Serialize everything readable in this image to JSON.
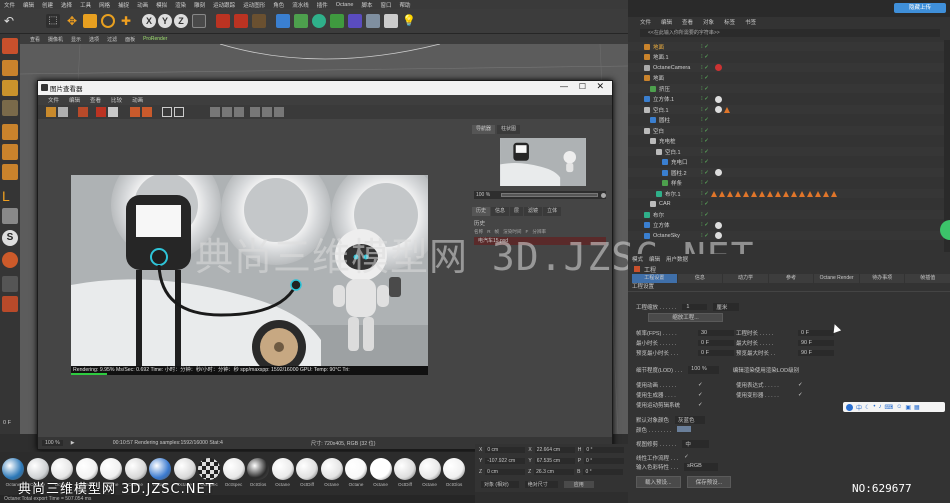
{
  "menubar": {
    "items": [
      "文件",
      "编辑",
      "创建",
      "选择",
      "工具",
      "网格",
      "捕捉",
      "动画",
      "模拟",
      "渲染",
      "雕刻",
      "运动跟踪",
      "运动图形",
      "角色",
      "流水线",
      "插件",
      "Octane",
      "脚本",
      "窗口",
      "帮助"
    ]
  },
  "viewport": {
    "menu": [
      "查看",
      "摄像机",
      "显示",
      "选项",
      "过滤",
      "面板",
      "ProRender"
    ]
  },
  "picture_viewer": {
    "title": "图片查看器",
    "menu": [
      "文件",
      "编辑",
      "查看",
      "比较",
      "动画"
    ],
    "tabs_top": [
      "导航器",
      "柱状图"
    ],
    "zoom": "100 %",
    "tabs_mid": [
      "历史",
      "信息",
      "层",
      "滤镜",
      "立体"
    ],
    "history_header": "历史",
    "history_cols": [
      "名称",
      "R",
      "帧",
      "渲染时间",
      "F",
      "分辨率"
    ],
    "history_row": "电汽车15.psd",
    "bottom_zoom": "100 %",
    "bottom_status": "00:10:57 Rendering samples:1592/16000 Stat:4",
    "bottom_size": "尺寸: 720x405, RGB (32 位)",
    "render_status": "Rendering: 9.95%   Ms/Sec: 0.692   Time: 小时：分钟：秒/小时：分钟：秒   spp/maxspp: 1592/16000   GPU:   Temp: 90°C   Tri:"
  },
  "object_manager": {
    "menu": [
      "文件",
      "编辑",
      "查看",
      "对象",
      "标签",
      "书签"
    ],
    "search_placeholder": "<<在此输入你所需要的字符串>>",
    "rows": [
      {
        "name": "地面",
        "indent": 1
      },
      {
        "name": "地面.1",
        "indent": 1
      },
      {
        "name": "OctaneCamera",
        "indent": 1
      },
      {
        "name": "地面",
        "indent": 1
      },
      {
        "name": "挤压",
        "indent": 2
      },
      {
        "name": "立方体.1",
        "indent": 1
      },
      {
        "name": "空白.1",
        "indent": 1
      },
      {
        "name": "圆柱",
        "indent": 2
      },
      {
        "name": "空白",
        "indent": 1
      },
      {
        "name": "充电桩",
        "indent": 2
      },
      {
        "name": "空白.1",
        "indent": 3
      },
      {
        "name": "充电口",
        "indent": 4
      },
      {
        "name": "圆柱.2",
        "indent": 4
      },
      {
        "name": "样条",
        "indent": 4
      },
      {
        "name": "布尔.1",
        "indent": 3
      },
      {
        "name": "CAR",
        "indent": 2
      },
      {
        "name": "布尔",
        "indent": 1
      },
      {
        "name": "立方体",
        "indent": 1
      },
      {
        "name": "OctaneSky",
        "indent": 1
      }
    ]
  },
  "attributes": {
    "menu": [
      "模式",
      "编辑",
      "用户数据"
    ],
    "title": "工程",
    "tabs": [
      "工程设置",
      "信息",
      "动力学",
      "参考",
      "Octane Render",
      "待办事项",
      "帧插值"
    ],
    "section": "工程设置",
    "scale_label": "工程缩放 . . . . . .",
    "scale_value": "1",
    "scale_unit": "厘米",
    "scale_button": "缩放工程...",
    "fields_left": [
      {
        "label": "帧率(FPS) . . . . .",
        "value": "30"
      },
      {
        "label": "最小时长 . . . . . .",
        "value": "0 F"
      },
      {
        "label": "预览最小时长 . . .",
        "value": "0 F"
      }
    ],
    "fields_right": [
      {
        "label": "工程时长 . . . . .",
        "value": "0 F"
      },
      {
        "label": "最大时长 . . . . .",
        "value": "90 F"
      },
      {
        "label": "预览最大时长 . .",
        "value": "90 F"
      }
    ],
    "lod_label": "细节程度(LOD) . . .",
    "lod_value": "100 %",
    "lod_right": "编辑渲染使用渲染LOD级别",
    "checks_left": [
      "使用动画 . . . . . .",
      "使用生成器 . . . .",
      "使用运动剪辑系统"
    ],
    "checks_right": [
      "使用表达式 . . . . .",
      "使用变形器 . . . . ."
    ],
    "default_color_label": "默认对象颜色",
    "default_color_value": "灰蓝色",
    "color_label": "颜色 . . . . . . . .",
    "view_clip_label": "视图修剪 . . . . . .",
    "view_clip_value": "中",
    "linear_label": "线性工作流程 . . .",
    "input_color_label": "输入色彩特性 . . .",
    "input_color_value": "sRGB",
    "buttons": [
      "载入预设...",
      "保存预设..."
    ]
  },
  "coords": {
    "rows": [
      {
        "a": "X",
        "av": "0 cm",
        "b": "X",
        "bv": "22.664 cm",
        "c": "H",
        "cv": "0 °"
      },
      {
        "a": "Y",
        "av": "-107.922 cm",
        "b": "Y",
        "bv": "67.535 cm",
        "c": "P",
        "cv": "0 °"
      },
      {
        "a": "Z",
        "av": "0 cm",
        "b": "Z",
        "bv": "26.3 cm",
        "c": "B",
        "cv": "0 °"
      }
    ],
    "mode1": "对象 (相对)",
    "mode2": "绝对尺寸",
    "apply": "应用"
  },
  "materials": {
    "labels": [
      "Octane",
      "Octane",
      "Octane",
      "Octane",
      "Octane",
      "Octane",
      "Octane",
      "Octane",
      "OctSpec",
      "OctSpec",
      "OctGlos",
      "Octane",
      "OctDiff",
      "Octane",
      "Octane",
      "Octane",
      "OctDiff",
      "Octane",
      "OctGlos"
    ]
  },
  "status_bar": "Octane:Total export Time = 507.054 ms",
  "upload_button": "隐藏上传",
  "watermark_center": "典尚三维模型网  3D.JZSC.NET",
  "watermark_bottom": "典尚三维模型网  3D.JZSC.NET",
  "watermark_no": "NO:629677",
  "frame_indicator": "0 F",
  "colors": {
    "accent": "#3f8fd9",
    "render_bg": "#b9bcbe"
  }
}
